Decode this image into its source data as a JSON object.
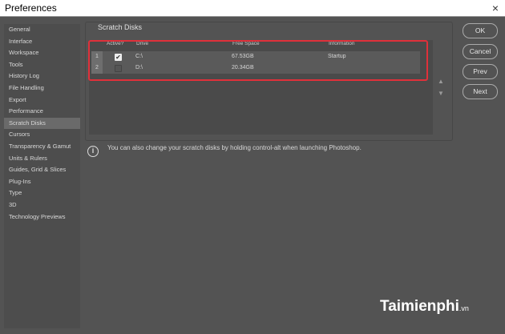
{
  "window": {
    "title": "Preferences",
    "close": "×"
  },
  "sidebar": {
    "items": [
      "General",
      "Interface",
      "Workspace",
      "Tools",
      "History Log",
      "File Handling",
      "Export",
      "Performance",
      "Scratch Disks",
      "Cursors",
      "Transparency & Gamut",
      "Units & Rulers",
      "Guides, Grid & Slices",
      "Plug-Ins",
      "Type",
      "3D",
      "Technology Previews"
    ],
    "active": "Scratch Disks"
  },
  "panel": {
    "title": "Scratch Disks",
    "columns": [
      "Active?",
      "Drive",
      "Free Space",
      "Information"
    ],
    "rows": [
      {
        "num": "1",
        "active": true,
        "drive": "C:\\",
        "free": "67.53GB",
        "info": "Startup"
      },
      {
        "num": "2",
        "active": false,
        "drive": "D:\\",
        "free": "20.34GB",
        "info": ""
      }
    ],
    "up": "▲",
    "down": "▼"
  },
  "info": {
    "icon": "i",
    "text": "You can also change your scratch disks by holding control-alt when launching Photoshop."
  },
  "buttons": {
    "ok": "OK",
    "cancel": "Cancel",
    "prev": "Prev",
    "next": "Next"
  },
  "watermark": {
    "brand": "Taimienphi",
    "tld": ".vn"
  },
  "colors": {
    "highlight": "#e0303a"
  }
}
